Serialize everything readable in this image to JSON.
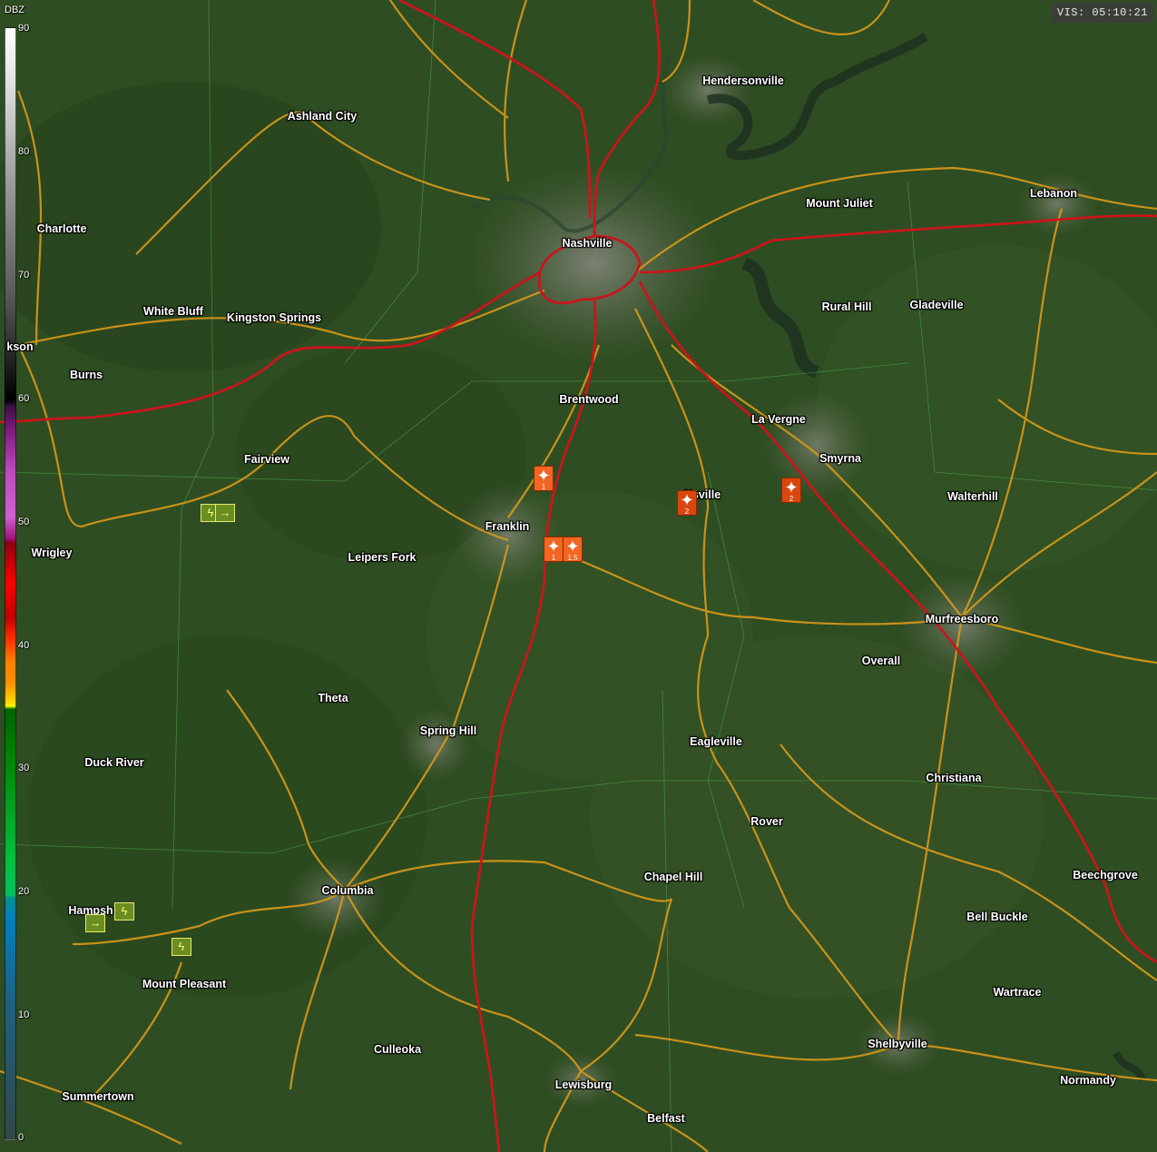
{
  "status": {
    "vis_text": "VIS: 05:10:21"
  },
  "legend": {
    "unit": "DBZ",
    "ticks": [
      "90",
      "80",
      "70",
      "60",
      "50",
      "40",
      "30",
      "20",
      "10",
      "0"
    ]
  },
  "cities": [
    "Hendersonville",
    "Ashland City",
    "Mount Juliet",
    "Lebanon",
    "Charlotte",
    "Nashville",
    "Rural Hill",
    "Gladeville",
    "White Bluff",
    "Kingston Springs",
    "kson",
    "Burns",
    "Brentwood",
    "La Vergne",
    "Smyrna",
    "Fairview",
    "Walterhill",
    "Nsville",
    "Franklin",
    "Wrigley",
    "Leipers Fork",
    "Murfreesboro",
    "Overall",
    "Theta",
    "Spring Hill",
    "Eagleville",
    "Duck River",
    "Christiana",
    "Rover",
    "Chapel Hill",
    "Beechgrove",
    "Columbia",
    "Hampsh",
    "Bell Buckle",
    "Mount Pleasant",
    "Wartrace",
    "Culleoka",
    "Shelbyville",
    "Lewisburg",
    "Normandy",
    "Summertown",
    "Belfast"
  ],
  "markers": [
    {
      "icon": "star-icon",
      "count": "1"
    },
    {
      "icon": "star-icon",
      "count": "2"
    },
    {
      "icon": "star-icon",
      "count": "2"
    },
    {
      "icon": "star-icon",
      "count": "1"
    },
    {
      "icon": "star-icon",
      "count": "1.5"
    }
  ],
  "warnings": [
    {
      "icon": "lightning-icon"
    },
    {
      "icon": "wind-arrow-icon"
    },
    {
      "icon": "lightning-icon"
    },
    {
      "icon": "wind-arrow-icon"
    },
    {
      "icon": "lightning-icon"
    }
  ],
  "colors": {
    "interstate": "#c8161b",
    "highway": "#d99a1a",
    "marker": "#f26522",
    "land": "#2f4d22"
  }
}
